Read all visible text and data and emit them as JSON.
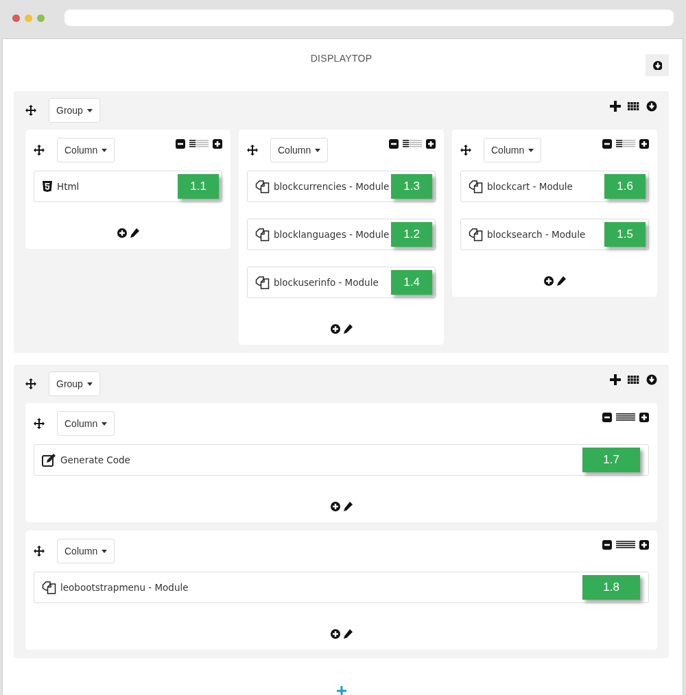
{
  "title": "DISPLAYTOP",
  "groups": [
    {
      "label": "Group",
      "kind": "row",
      "columns": [
        {
          "label": "Column",
          "level": 0.33,
          "items": [
            {
              "kind": "html",
              "name": "Html",
              "badge": "1.1"
            }
          ]
        },
        {
          "label": "Column",
          "level": 0.33,
          "items": [
            {
              "kind": "module",
              "name": "blockcurrencies - Module",
              "badge": "1.3"
            },
            {
              "kind": "module",
              "name": "blocklanguages - Module",
              "badge": "1.2"
            },
            {
              "kind": "module",
              "name": "blockuserinfo - Module",
              "badge": "1.4"
            }
          ]
        },
        {
          "label": "Column",
          "level": 0.33,
          "items": [
            {
              "kind": "module",
              "name": "blockcart - Module",
              "badge": "1.6"
            },
            {
              "kind": "module",
              "name": "blocksearch - Module",
              "badge": "1.5"
            }
          ]
        }
      ]
    },
    {
      "label": "Group",
      "kind": "stack",
      "columns": [
        {
          "label": "Column",
          "level": 1,
          "items": [
            {
              "kind": "code",
              "name": "Generate Code",
              "badge": "1.7"
            }
          ]
        },
        {
          "label": "Column",
          "level": 1,
          "items": [
            {
              "kind": "module",
              "name": "leobootstrapmenu - Module",
              "badge": "1.8"
            }
          ]
        }
      ]
    }
  ]
}
